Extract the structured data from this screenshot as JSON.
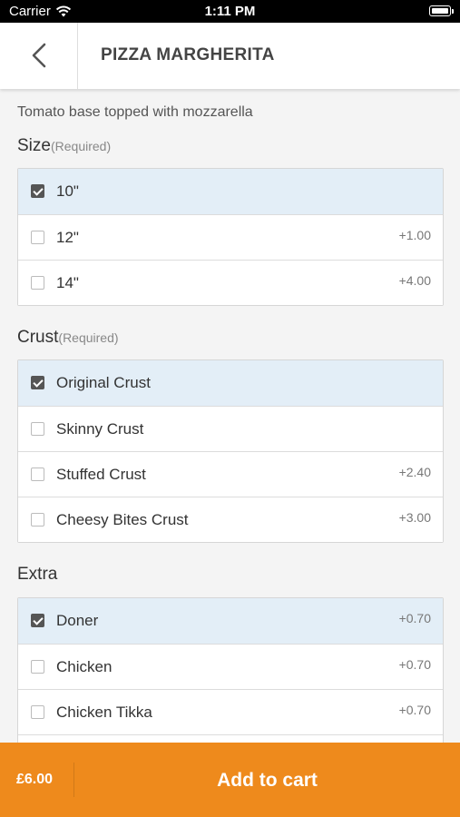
{
  "status_bar": {
    "carrier": "Carrier",
    "time": "1:11 PM"
  },
  "header": {
    "title": "PIZZA MARGHERITA"
  },
  "description": "Tomato base topped with mozzarella",
  "sections": {
    "size": {
      "title": "Size",
      "required": "(Required)",
      "options": [
        {
          "label": "10\"",
          "price": "",
          "checked": true
        },
        {
          "label": "12\"",
          "price": "+1.00",
          "checked": false
        },
        {
          "label": "14\"",
          "price": "+4.00",
          "checked": false
        }
      ]
    },
    "crust": {
      "title": "Crust",
      "required": "(Required)",
      "options": [
        {
          "label": "Original Crust",
          "price": "",
          "checked": true
        },
        {
          "label": "Skinny Crust",
          "price": "",
          "checked": false
        },
        {
          "label": "Stuffed Crust",
          "price": "+2.40",
          "checked": false
        },
        {
          "label": "Cheesy Bites Crust",
          "price": "+3.00",
          "checked": false
        }
      ]
    },
    "extra": {
      "title": "Extra",
      "options": [
        {
          "label": "Doner",
          "price": "+0.70",
          "checked": true
        },
        {
          "label": "Chicken",
          "price": "+0.70",
          "checked": false
        },
        {
          "label": "Chicken Tikka",
          "price": "+0.70",
          "checked": false
        },
        {
          "label": "",
          "price": "",
          "checked": false
        }
      ]
    }
  },
  "footer": {
    "total": "£6.00",
    "add_label": "Add to cart"
  },
  "colors": {
    "accent": "#ee8a1c",
    "selected_row": "#e3eef7"
  }
}
